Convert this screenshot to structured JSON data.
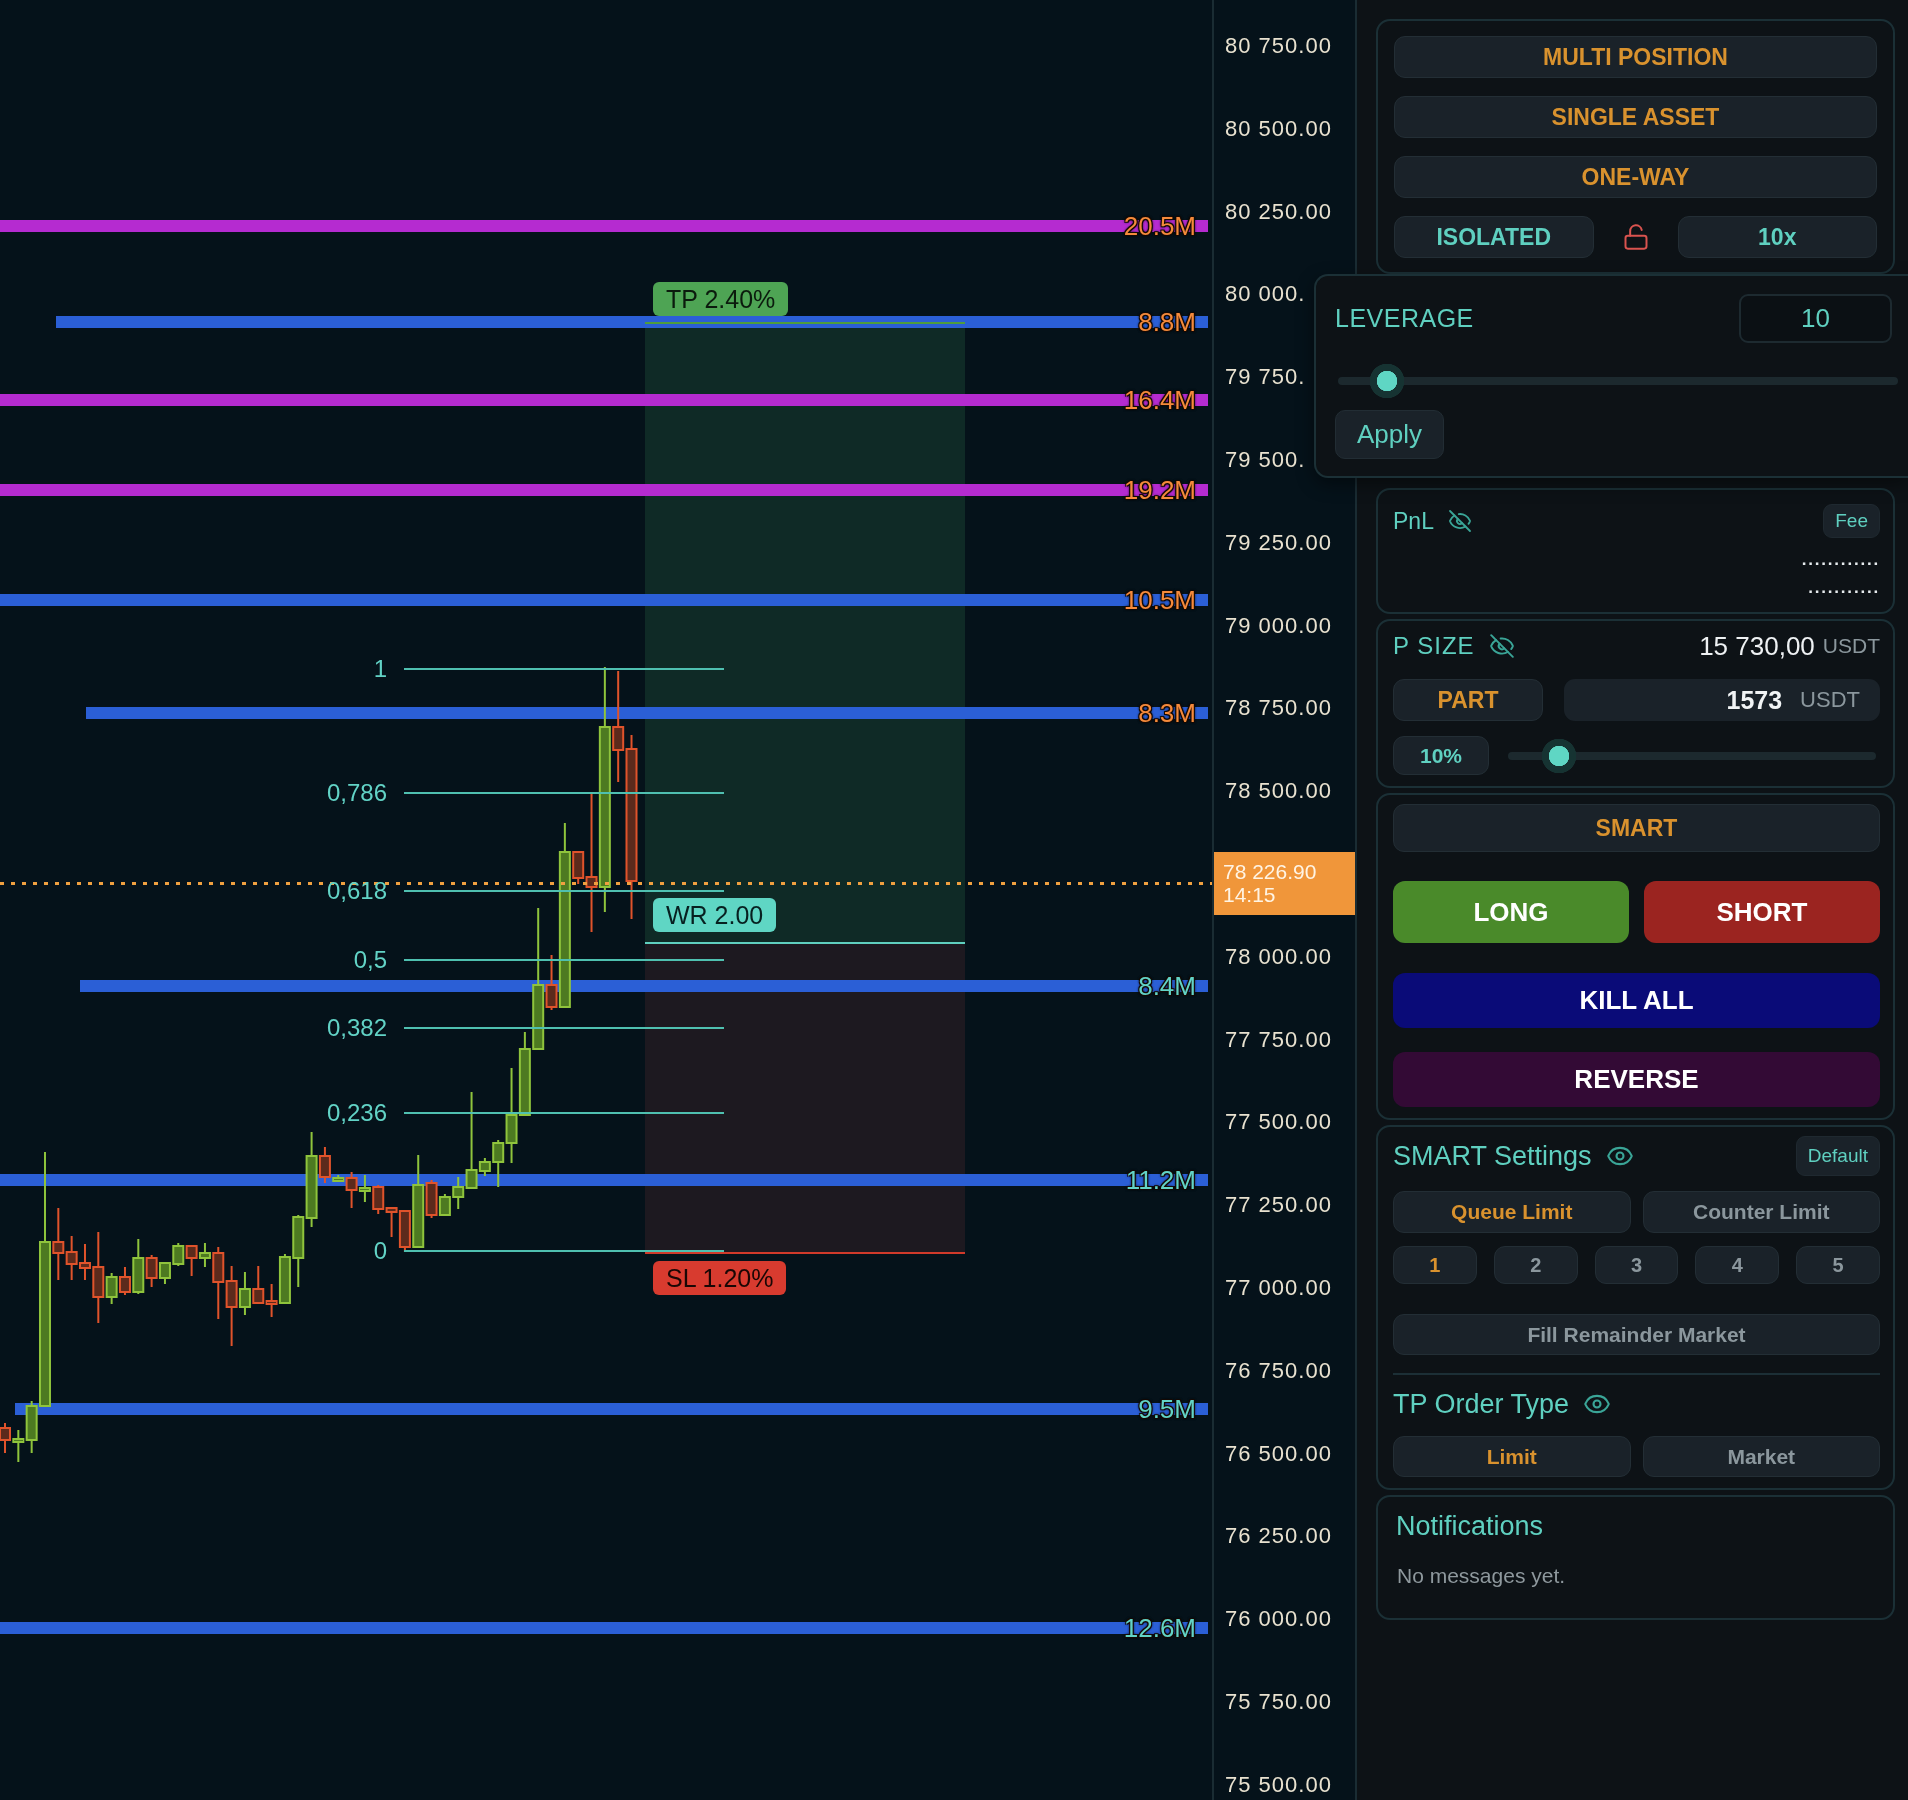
{
  "chart": {
    "volume_levels": [
      {
        "bar": {
          "color": "#b52bd0"
        },
        "tag": {
          "text": "20.5M",
          "color": "#f58a3b"
        }
      },
      {
        "bar": {
          "color": "#2b5fd6"
        },
        "tag": {
          "text": "8.8M",
          "color": "#f58a3b"
        }
      },
      {
        "bar": {
          "color": "#b52bd0"
        },
        "tag": {
          "text": "16.4M",
          "color": "#f58a3b"
        }
      },
      {
        "bar": {
          "color": "#b52bd0"
        },
        "tag": {
          "text": "19.2M",
          "color": "#f58a3b"
        }
      },
      {
        "bar": {
          "color": "#2b5fd6"
        },
        "tag": {
          "text": "10.5M",
          "color": "#f58a3b"
        }
      },
      {
        "bar": {
          "color": "#2b5fd6"
        },
        "tag": {
          "text": "8.3M",
          "color": "#f58a3b"
        }
      },
      {
        "bar": {
          "color": "#2b5fd6"
        },
        "tag": {
          "text": "8.4M",
          "color": "#62d3c6"
        }
      },
      {
        "bar": {
          "color": "#2b5fd6"
        },
        "tag": {
          "text": "11.2M",
          "color": "#62d3c6"
        }
      },
      {
        "bar": {
          "color": "#2b5fd6"
        },
        "tag": {
          "text": "9.5M",
          "color": "#62d3c6"
        }
      },
      {
        "bar": {
          "color": "#2b5fd6"
        },
        "tag": {
          "text": "12.6M",
          "color": "#62d3c6"
        }
      }
    ],
    "fib_levels": [
      "1",
      "0,786",
      "0,618",
      "0,5",
      "0,382",
      "0,236",
      "0"
    ],
    "position_tool": {
      "take_profit": "TP 2.40%",
      "ratio": "WR 2.00",
      "stop_loss": "SL 1.20%"
    }
  },
  "price_axis": {
    "labels": [
      "80 750.00",
      "80 500.00",
      "80 250.00",
      "80 000.",
      "79 750.",
      "79 500.",
      "79 250.00",
      "79 000.00",
      "78 750.00",
      "78 500.00",
      "78 000.00",
      "77 750.00",
      "77 500.00",
      "77 250.00",
      "77 000.00",
      "76 750.00",
      "76 500.00",
      "76 250.00",
      "76 000.00",
      "75 750.00",
      "75 500.00"
    ],
    "last_price": {
      "price": "78 226.90",
      "time": "14:15"
    }
  },
  "account_modes": {
    "buttons": [
      "MULTI POSITION",
      "SINGLE ASSET",
      "ONE-WAY"
    ],
    "margin_mode": "ISOLATED",
    "locked": false,
    "leverage": "10x"
  },
  "leverage_popup": {
    "title": "LEVERAGE",
    "value": "10",
    "level": 0.06,
    "apply": "Apply"
  },
  "pnl": {
    "title": "PnL",
    "hidden": true,
    "fee": "Fee",
    "values": [
      "............",
      "..........."
    ]
  },
  "position_size": {
    "title": "P SIZE",
    "hidden": true,
    "amount": "15 730,00",
    "unit": "USDT",
    "part": "PART",
    "part_amount": "1573",
    "part_unit": "USDT",
    "percent": "10%",
    "level": 0.1
  },
  "orders": {
    "smart": "SMART",
    "long": "LONG",
    "short": "SHORT",
    "kill_all": "KILL ALL",
    "reverse": "REVERSE"
  },
  "smart_settings": {
    "title": "SMART Settings",
    "hidden": false,
    "default": "Default",
    "limit_types": [
      {
        "label": "Queue Limit",
        "selected": true
      },
      {
        "label": "Counter Limit",
        "selected": false
      }
    ],
    "levels": [
      {
        "label": "1",
        "selected": true
      },
      {
        "label": "2",
        "selected": false
      },
      {
        "label": "3",
        "selected": false
      },
      {
        "label": "4",
        "selected": false
      },
      {
        "label": "5",
        "selected": false
      }
    ],
    "fill_remainder": {
      "label": "Fill Remainder Market",
      "on": false
    }
  },
  "tp_order_type": {
    "title": "TP Order Type",
    "hidden": false,
    "options": [
      {
        "label": "Limit",
        "selected": true
      },
      {
        "label": "Market",
        "selected": false
      }
    ]
  },
  "notifications": {
    "title": "Notifications",
    "message": "No messages yet."
  }
}
